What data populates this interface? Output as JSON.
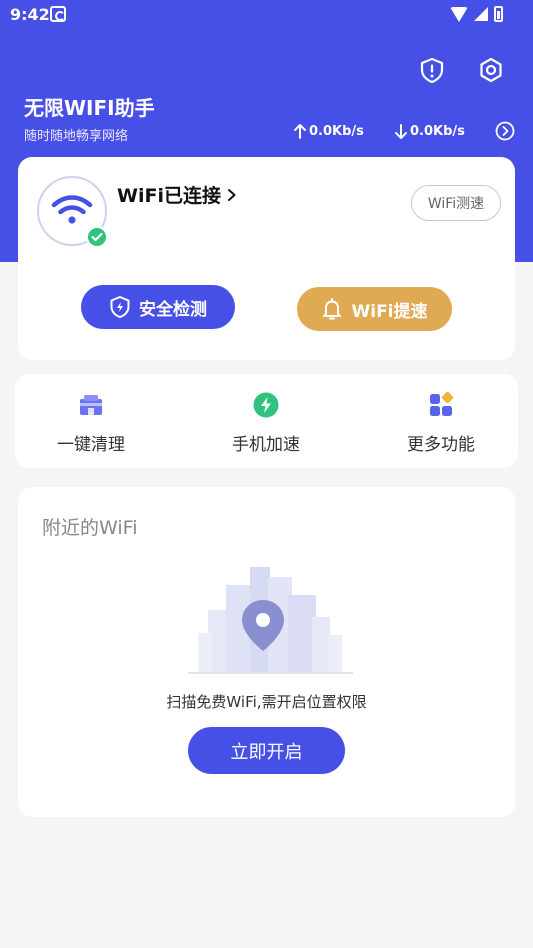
{
  "status_bar": {
    "time": "9:42"
  },
  "header": {
    "app_title": "无限WIFI助手",
    "subtitle": "随时随地畅享网络",
    "upload_speed": "0.0Kb/s",
    "download_speed": "0.0Kb/s"
  },
  "connection": {
    "status_text": "WiFi已连接",
    "speedtest_label": "WiFi测速",
    "security_label": "安全检测",
    "boost_label": "WiFi提速"
  },
  "tools": [
    {
      "label": "一键清理",
      "icon": "clean-icon"
    },
    {
      "label": "手机加速",
      "icon": "bolt-icon"
    },
    {
      "label": "更多功能",
      "icon": "grid-icon"
    }
  ],
  "nearby": {
    "title": "附近的WiFi",
    "hint": "扫描免费WiFi,需开启位置权限",
    "button_label": "立即开启"
  },
  "colors": {
    "primary": "#4750e6",
    "accent_gold": "#e0aa55",
    "success": "#2fc37d",
    "background": "#f5f5f7"
  }
}
